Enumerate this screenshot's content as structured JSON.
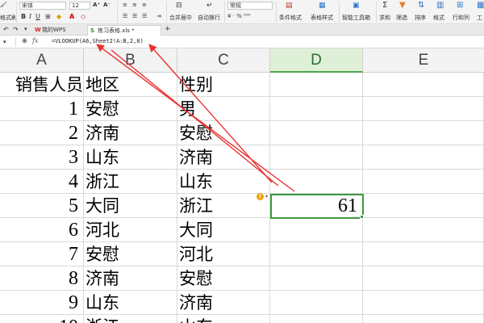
{
  "ribbon": {
    "left_fragment": "格式刷",
    "font_name": "宋体",
    "font_size": "12",
    "merge_center": "合并居中",
    "wrap_text": "自动换行",
    "number_format": "常规",
    "conditional_format": "条件格式",
    "table_style": "表格样式",
    "smart_tools": "智能工具箱",
    "sum": "求和",
    "filter": "筛选",
    "sort": "排序",
    "format": "格式",
    "row_col": "行和列",
    "worksheet_fragment": "工"
  },
  "tabs": [
    {
      "label": "我的WPS"
    },
    {
      "label": "练习表格.xls *"
    }
  ],
  "formula_bar": {
    "fx_label": "fx",
    "formula": "=VLOOKUP(A6,Sheet2!A:B,2,0)"
  },
  "columns": [
    "A",
    "B",
    "C",
    "D",
    "E"
  ],
  "rows": [
    {
      "a": "销售人员",
      "b": "地区",
      "c": "性别",
      "d": ""
    },
    {
      "a": "1",
      "b": "安慰",
      "c": "男",
      "d": ""
    },
    {
      "a": "2",
      "b": "济南",
      "c": "安慰",
      "d": ""
    },
    {
      "a": "3",
      "b": "山东",
      "c": "济南",
      "d": ""
    },
    {
      "a": "4",
      "b": "浙江",
      "c": "山东",
      "d": ""
    },
    {
      "a": "5",
      "b": "大同",
      "c": "浙江",
      "d": "61"
    },
    {
      "a": "6",
      "b": "河北",
      "c": "大同",
      "d": ""
    },
    {
      "a": "7",
      "b": "安慰",
      "c": "河北",
      "d": ""
    },
    {
      "a": "8",
      "b": "济南",
      "c": "安慰",
      "d": ""
    },
    {
      "a": "9",
      "b": "山东",
      "c": "济南",
      "d": ""
    },
    {
      "a": "10",
      "b": "浙江",
      "c": "山东",
      "d": ""
    }
  ],
  "colors": {
    "accent_green": "#3d9a3d",
    "annotation_red": "#e8312f"
  }
}
